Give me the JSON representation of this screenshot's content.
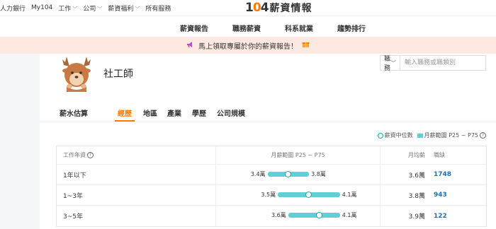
{
  "topbar": {
    "links": [
      {
        "label": "人力銀行",
        "dropdown": false
      },
      {
        "label": "My104",
        "dropdown": false
      },
      {
        "label": "工作",
        "dropdown": true
      },
      {
        "label": "公司",
        "dropdown": true
      },
      {
        "label": "薪資福利",
        "dropdown": true
      },
      {
        "label": "所有服務",
        "dropdown": false
      }
    ],
    "logo_number": "104",
    "logo_text": "薪資情報"
  },
  "nav": [
    "薪資報告",
    "職務薪資",
    "科系就業",
    "趨勢排行"
  ],
  "banner": {
    "text": "馬上領取專屬於你的薪資報告！"
  },
  "job": {
    "title": "社工師"
  },
  "search": {
    "category": "職務",
    "placeholder": "輸入職務或職類別"
  },
  "tabs": [
    "薪水估算",
    "經歷",
    "地區",
    "產業",
    "學歷",
    "公司規模"
  ],
  "active_tab": "經歷",
  "legend": {
    "median": "薪資中位數",
    "range": "月薪範圍 P25 ~ P75"
  },
  "table": {
    "headers": {
      "experience": "工作年資",
      "range": "月薪範圍 P25 ~ P75",
      "avg": "月均薪",
      "count": "職缺"
    },
    "rows": [
      {
        "experience": "1年以下",
        "p25": "3.4萬",
        "p75": "3.8萬",
        "p25_value": 3.4,
        "median_value": 3.6,
        "p75_value": 3.8,
        "avg": "3.6萬",
        "count": "1748"
      },
      {
        "experience": "1~3年",
        "p25": "3.5萬",
        "p75": "4.1萬",
        "p25_value": 3.5,
        "median_value": 3.8,
        "p75_value": 4.1,
        "avg": "3.8萬",
        "count": "943"
      },
      {
        "experience": "3~5年",
        "p25": "3.6萬",
        "p75": "4.1萬",
        "p25_value": 3.6,
        "median_value": 3.9,
        "p75_value": 4.1,
        "avg": "3.9萬",
        "count": "122"
      }
    ]
  },
  "colors": {
    "accent": "#ff7800",
    "range": "#5fd0d6",
    "median": "#1da7a5",
    "count_link": "#1e6fb4",
    "banner_bg": "#fde9e1"
  },
  "icons": [
    "search-dropdown-icon",
    "megaphone-icon",
    "gift-icon",
    "help-icon",
    "deer-mascot-icon"
  ]
}
